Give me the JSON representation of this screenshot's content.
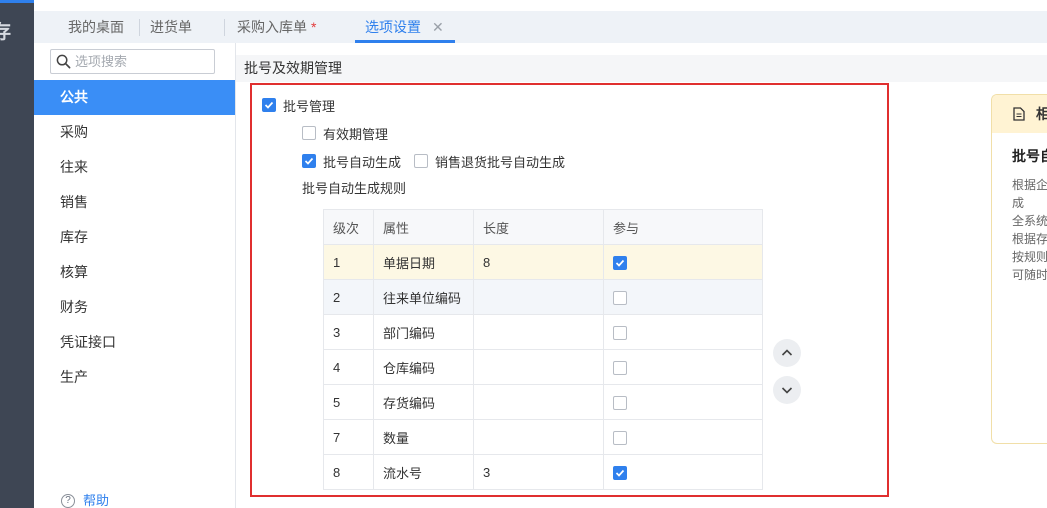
{
  "corner": {
    "glyph": "存"
  },
  "tabs": {
    "items": [
      {
        "label": "我的桌面",
        "active": false
      },
      {
        "label": "进货单",
        "active": false
      },
      {
        "label": "采购入库单",
        "modified_mark": "*",
        "active": false
      },
      {
        "label": "选项设置",
        "close": "✕",
        "active": true
      }
    ]
  },
  "search": {
    "placeholder": "选项搜索",
    "icon": "search-icon"
  },
  "nav": {
    "items": [
      "公共",
      "采购",
      "往来",
      "销售",
      "库存",
      "核算",
      "财务",
      "凭证接口",
      "生产"
    ],
    "selected_index": 0
  },
  "help": {
    "label": "帮助",
    "icon": "question-circle-icon"
  },
  "section": {
    "title": "批号及效期管理"
  },
  "options": {
    "batch_management": {
      "label": "批号管理",
      "checked": true
    },
    "expiry_management": {
      "label": "有效期管理",
      "checked": false
    },
    "batch_auto_generate": {
      "label": "批号自动生成",
      "checked": true
    },
    "sales_return_batch_auto_generate": {
      "label": "销售退货批号自动生成",
      "checked": false
    }
  },
  "rule_table": {
    "title": "批号自动生成规则",
    "columns": [
      "级次",
      "属性",
      "长度",
      "参与"
    ],
    "rows": [
      {
        "level": "1",
        "attribute": "单据日期",
        "length": "8",
        "included": true
      },
      {
        "level": "2",
        "attribute": "往来单位编码",
        "length": "",
        "included": false
      },
      {
        "level": "3",
        "attribute": "部门编码",
        "length": "",
        "included": false
      },
      {
        "level": "4",
        "attribute": "仓库编码",
        "length": "",
        "included": false
      },
      {
        "level": "5",
        "attribute": "存货编码",
        "length": "",
        "included": false
      },
      {
        "level": "7",
        "attribute": "数量",
        "length": "",
        "included": false
      },
      {
        "level": "8",
        "attribute": "流水号",
        "length": "3",
        "included": true
      }
    ],
    "selected_row": 0,
    "hover_row": 1
  },
  "reorder": {
    "up_icon": "chevron-up-icon",
    "down_icon": "chevron-down-icon"
  },
  "info_panel": {
    "icon": "document-icon",
    "header": "相",
    "title": "批号自",
    "lines": [
      "根据企",
      "成",
      "全系统",
      "根据存",
      "按规则",
      "可随时"
    ]
  },
  "colors": {
    "accent": "#2f80ed",
    "nav_selected": "#3a8ef6",
    "sidebar": "#3e4654",
    "highlight_border": "#e02f2f",
    "row_highlight": "#fdf8e4",
    "info_header": "#fff3d3"
  }
}
